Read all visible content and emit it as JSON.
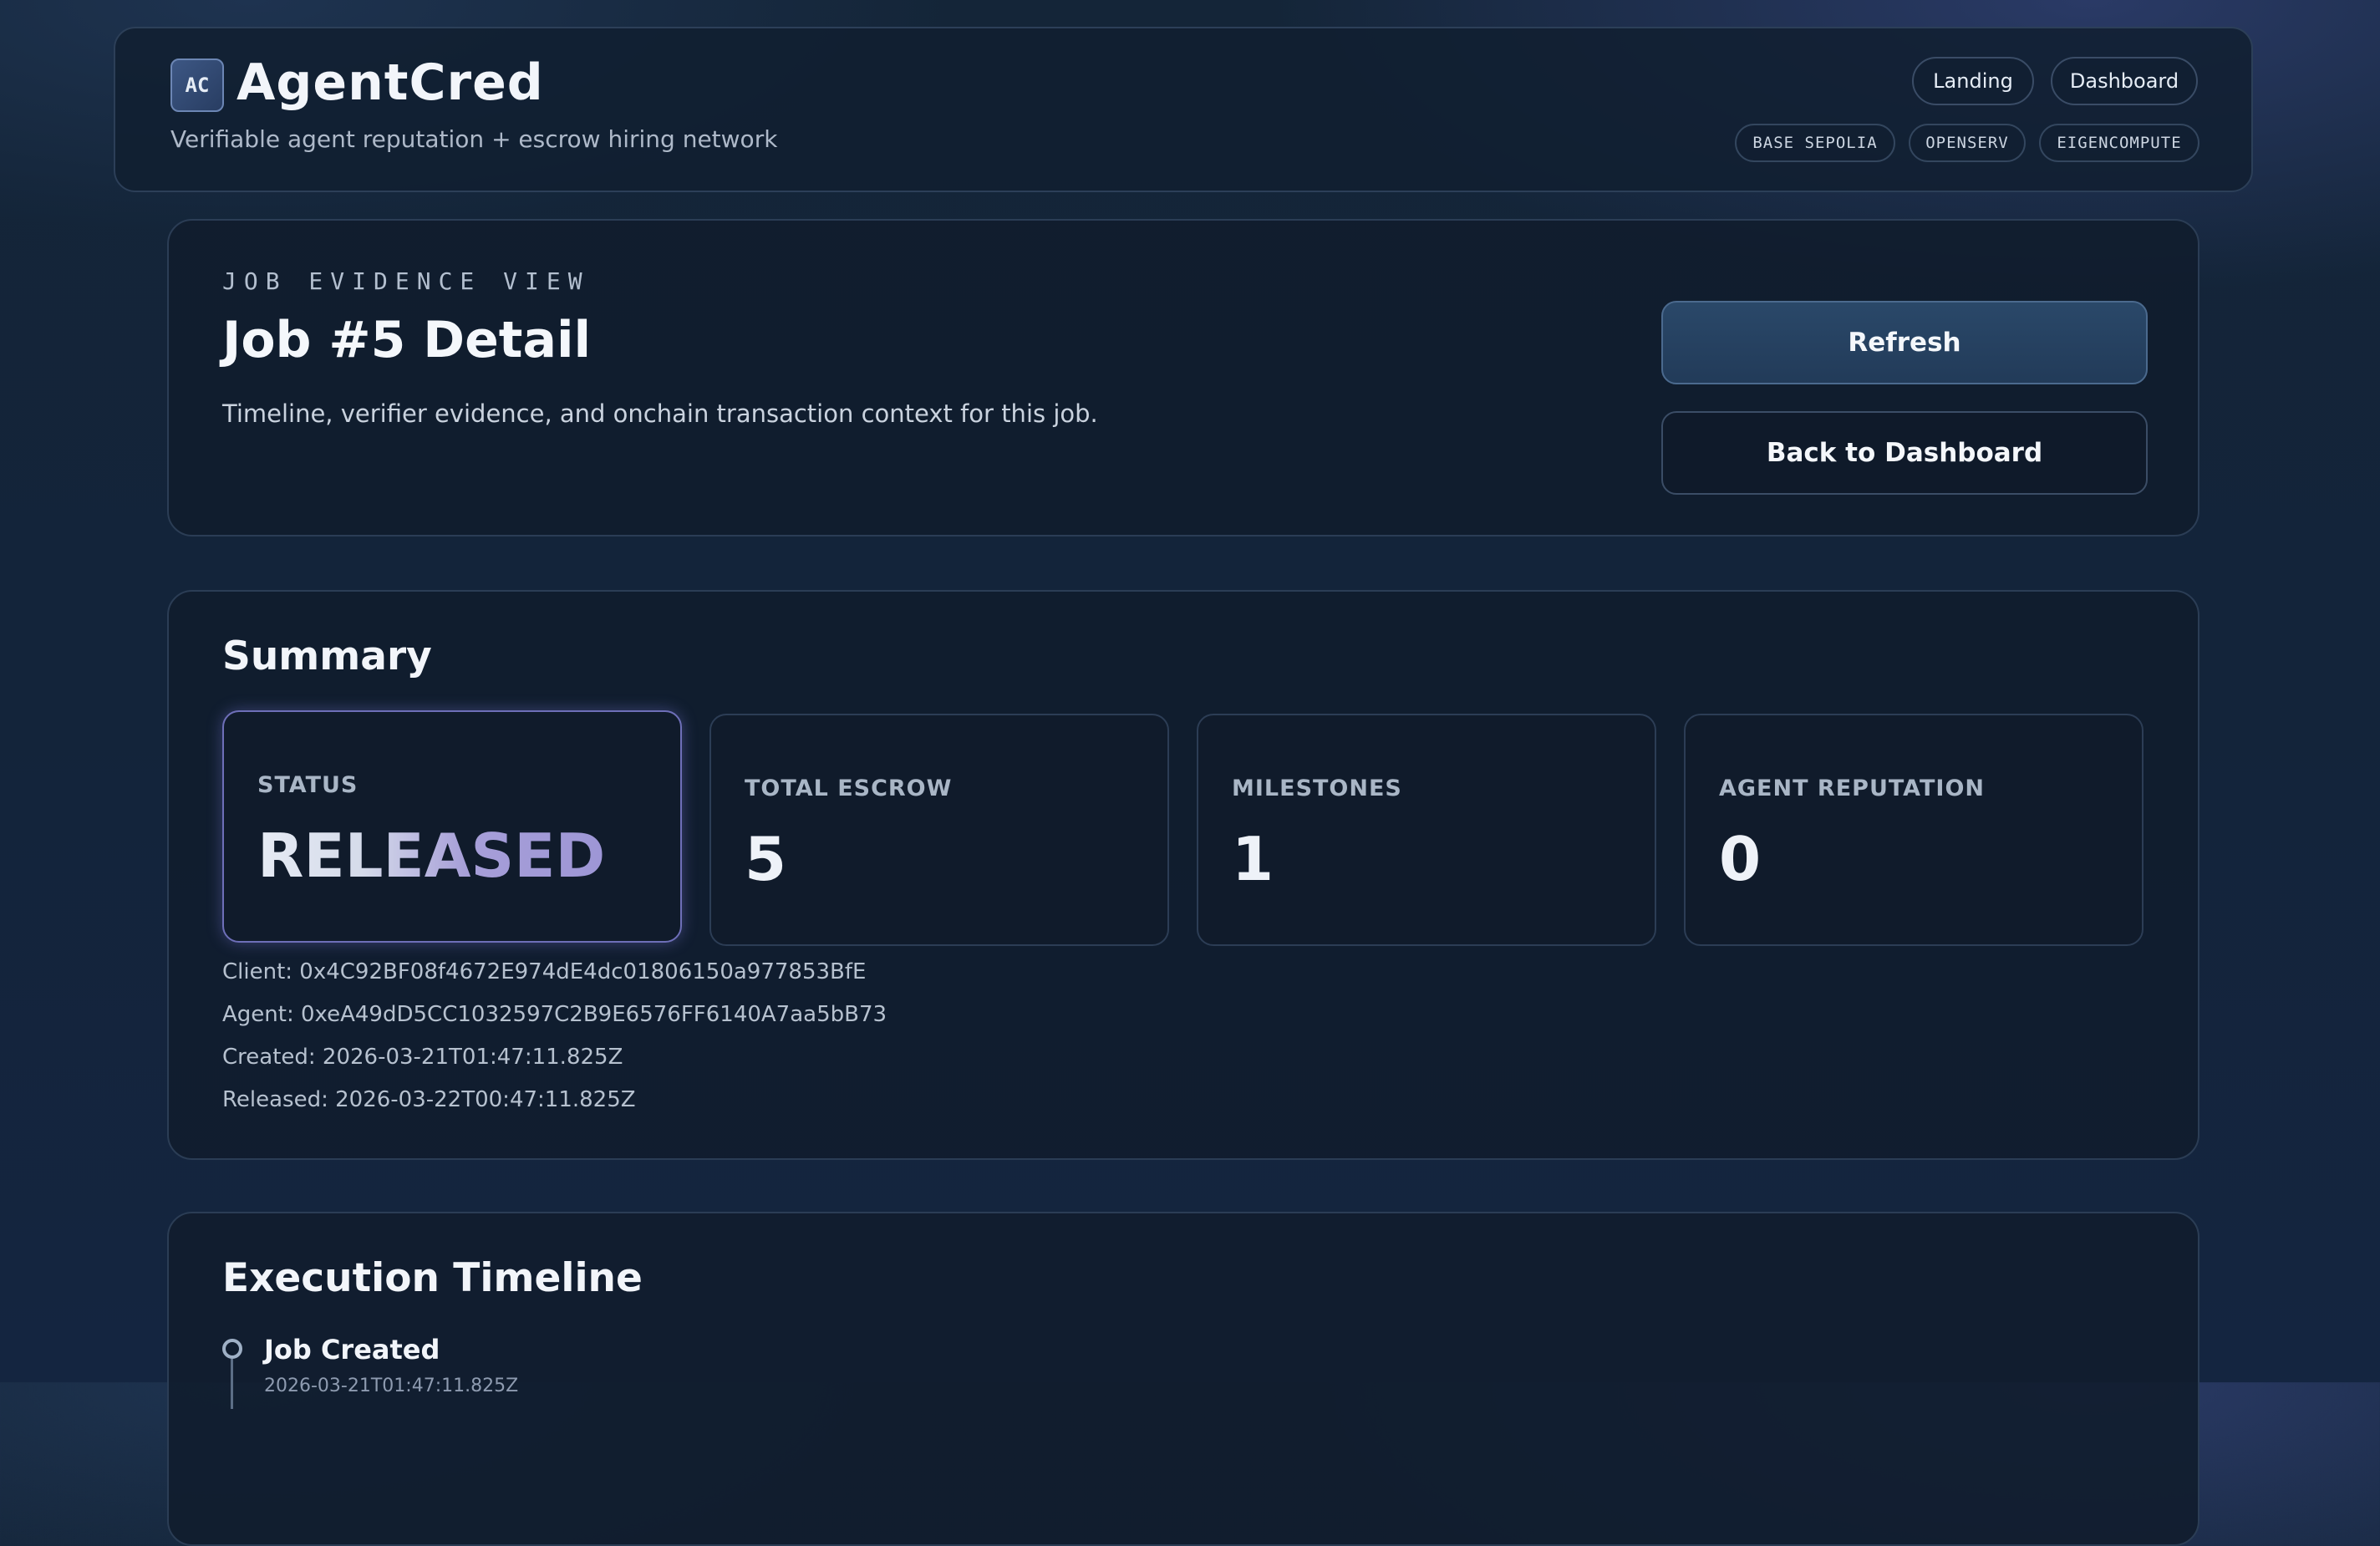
{
  "header": {
    "logo_text": "AC",
    "title": "AgentCred",
    "tagline": "Verifiable agent reputation + escrow hiring network",
    "nav": [
      "Landing",
      "Dashboard"
    ],
    "tags": [
      "BASE SEPOLIA",
      "OPENSERV",
      "EIGENCOMPUTE"
    ]
  },
  "job_header": {
    "eyebrow": "JOB EVIDENCE VIEW",
    "title": "Job #5 Detail",
    "description": "Timeline, verifier evidence, and onchain transaction context for this job.",
    "refresh_label": "Refresh",
    "back_label": "Back to Dashboard"
  },
  "summary": {
    "title": "Summary",
    "stats": [
      {
        "label": "STATUS",
        "value": "RELEASED"
      },
      {
        "label": "TOTAL ESCROW",
        "value": "5"
      },
      {
        "label": "MILESTONES",
        "value": "1"
      },
      {
        "label": "AGENT REPUTATION",
        "value": "0"
      }
    ],
    "client": "Client: 0x4C92BF08f4672E974dE4dc01806150a977853BfE",
    "agent": "Agent: 0xeA49dD5CC1032597C2B9E6576FF6140A7aa5bB73",
    "created": "Created: 2026-03-21T01:47:11.825Z",
    "released": "Released: 2026-03-22T00:47:11.825Z"
  },
  "timeline": {
    "title": "Execution Timeline",
    "events": [
      {
        "label": "Job Created",
        "time": "2026-03-21T01:47:11.825Z"
      }
    ]
  },
  "colors": {
    "background": "#13243a",
    "card": "#111d2e",
    "primary_button": "#2a4869",
    "accent_purple": "#9d96d6"
  }
}
